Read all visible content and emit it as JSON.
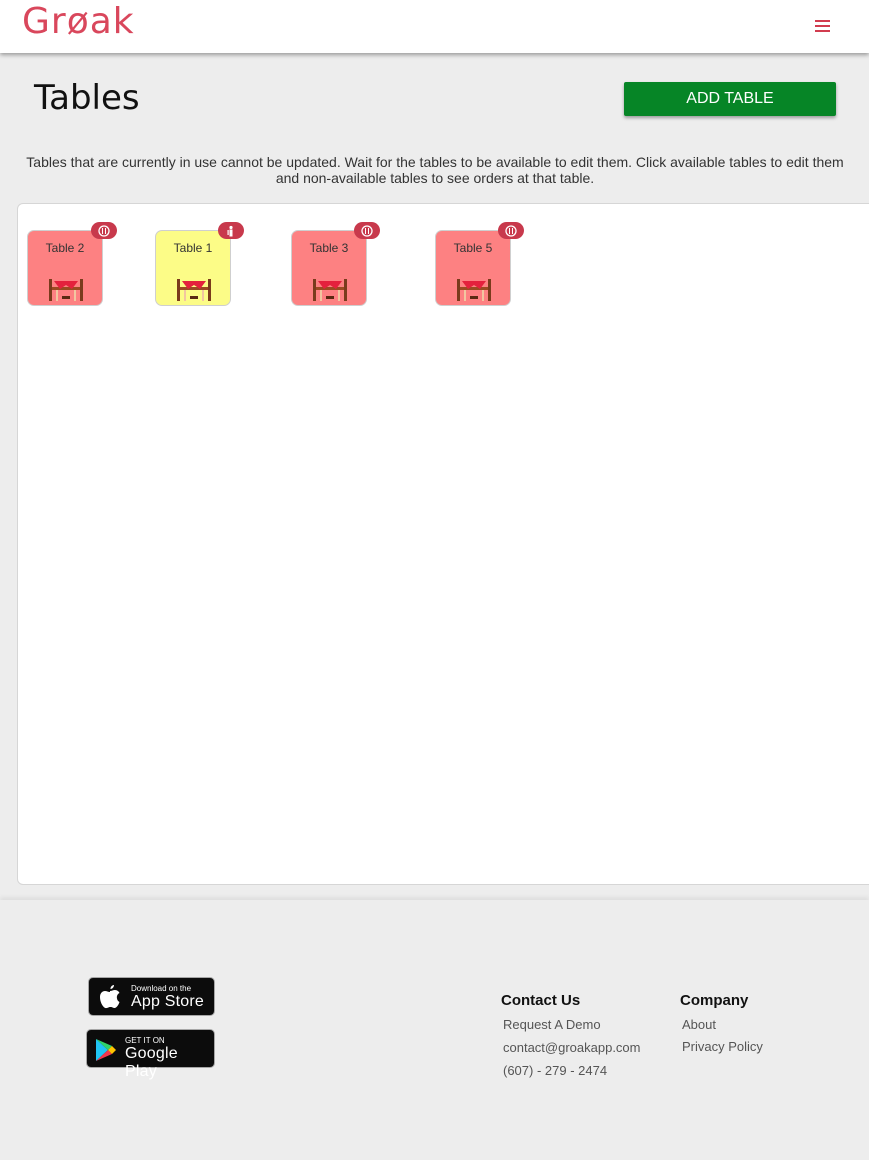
{
  "header": {
    "logo_text": "Grøak",
    "brand_color": "#d9475c"
  },
  "page": {
    "title": "Tables",
    "add_button_label": "ADD TABLE",
    "description": "Tables that are currently in use cannot be updated. Wait for the tables to be available to edit them. Click available tables to edit them and non-available tables to see orders at that table."
  },
  "tables": [
    {
      "label": "Table 2",
      "status": "occupied",
      "badge_icon": "utensils-icon",
      "color": "#fd8182"
    },
    {
      "label": "Table 1",
      "status": "available",
      "badge_icon": "person-icon",
      "color": "#fcfc87"
    },
    {
      "label": "Table 3",
      "status": "occupied",
      "badge_icon": "utensils-icon",
      "color": "#fd8182"
    },
    {
      "label": "Table 5",
      "status": "occupied",
      "badge_icon": "utensils-icon",
      "color": "#fd8182"
    }
  ],
  "footer": {
    "app_store": {
      "small": "Download on the",
      "big": "App Store"
    },
    "google_play": {
      "small": "GET IT ON",
      "big": "Google Play"
    },
    "contact": {
      "heading": "Contact Us",
      "links": [
        "Request A Demo",
        "contact@groakapp.com",
        "(607) - 279 - 2474"
      ]
    },
    "company": {
      "heading": "Company",
      "links": [
        "About",
        "Privacy Policy"
      ]
    }
  },
  "colors": {
    "add_button": "#068526",
    "badge": "#c8394c"
  }
}
